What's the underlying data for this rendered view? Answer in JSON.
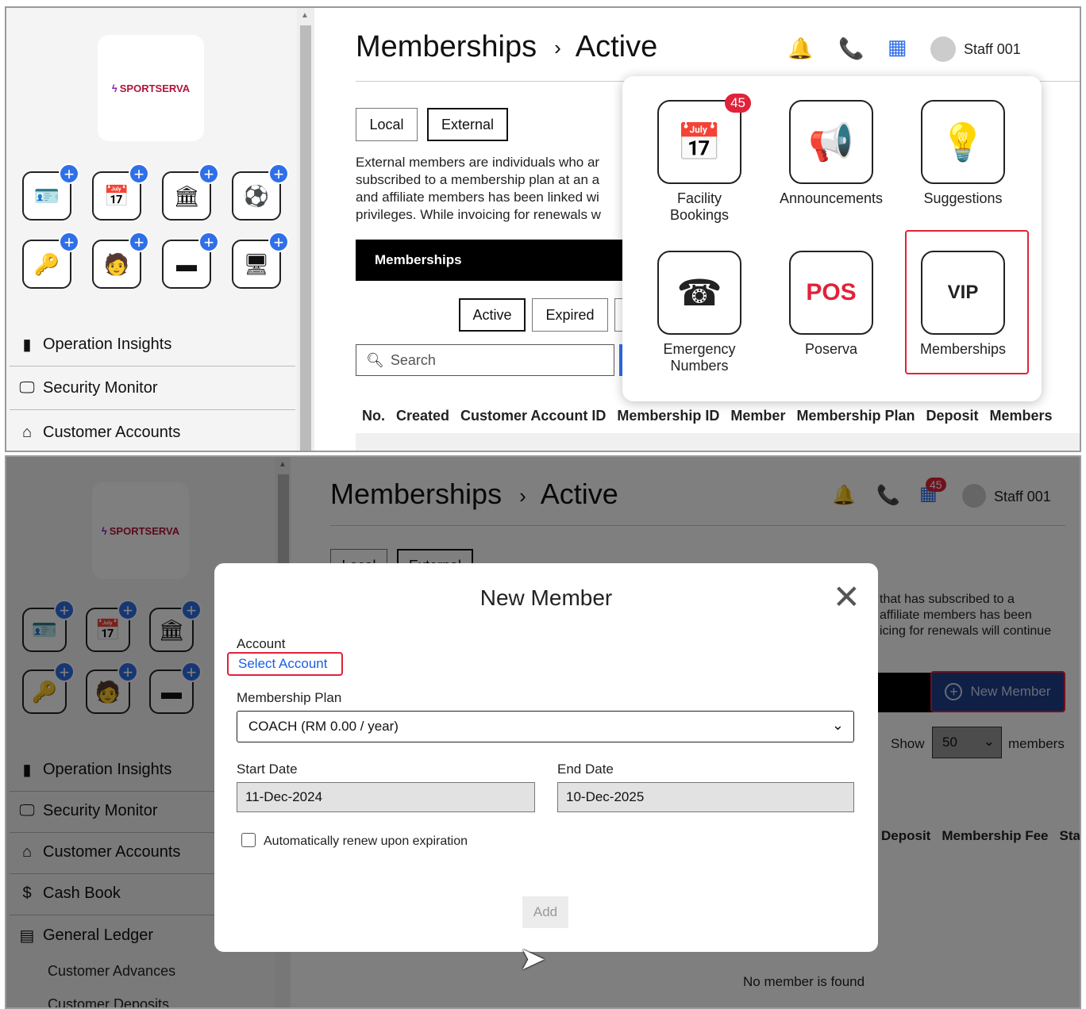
{
  "brand": "SPORTSERVA",
  "header": {
    "title": "Memberships",
    "subtitle": "Active",
    "staff": "Staff 001",
    "notif_count": "45"
  },
  "sidebar": {
    "items": [
      {
        "label": "Operation Insights",
        "icon": "bar-chart-icon"
      },
      {
        "label": "Security Monitor",
        "icon": "monitor-icon"
      },
      {
        "label": "Customer Accounts",
        "icon": "home-icon"
      },
      {
        "label": "Cash Book",
        "icon": "dollar-circle-icon"
      },
      {
        "label": "General Ledger",
        "icon": "ledger-icon"
      }
    ],
    "subitems": [
      "Customer Advances",
      "Customer Deposits"
    ]
  },
  "tabs": {
    "local": "Local",
    "external": "External"
  },
  "description_lines": [
    "External members are individuals who ar",
    "subscribed to a membership plan at an a",
    "and affiliate members has been linked wi",
    "privileges. While invoicing for renewals w"
  ],
  "bar_label": "Memberships",
  "filters": {
    "active": "Active",
    "expired": "Expired"
  },
  "search": {
    "placeholder": "Search"
  },
  "columns": [
    "No.",
    "Created",
    "Customer Account ID",
    "Membership ID",
    "Member",
    "Membership Plan",
    "Deposit",
    "Members"
  ],
  "popup": {
    "tiles": [
      {
        "label1": "Facility",
        "label2": "Bookings",
        "badge": "45"
      },
      {
        "label1": "Announcements",
        "label2": ""
      },
      {
        "label1": "Suggestions",
        "label2": ""
      },
      {
        "label1": "Emergency",
        "label2": "Numbers"
      },
      {
        "label1": "Poserva",
        "label2": ""
      },
      {
        "label1": "Memberships",
        "label2": ""
      }
    ]
  },
  "bottom": {
    "desc_lines": [
      "that has subscribed to a",
      "affiliate members has been",
      "icing for renewals will continue"
    ],
    "new_member": "New Member",
    "show": "Show",
    "show_value": "50",
    "members": "members",
    "columns": [
      "Deposit",
      "Membership Fee",
      "Sta"
    ],
    "empty": "No member is found"
  },
  "modal": {
    "title": "New Member",
    "account_label": "Account",
    "account_link": "Select Account",
    "plan_label": "Membership Plan",
    "plan_value": "COACH (RM 0.00 / year)",
    "start_label": "Start Date",
    "start_value": "11-Dec-2024",
    "end_label": "End Date",
    "end_value": "10-Dec-2025",
    "auto_renew": "Automatically renew upon expiration",
    "add": "Add"
  }
}
